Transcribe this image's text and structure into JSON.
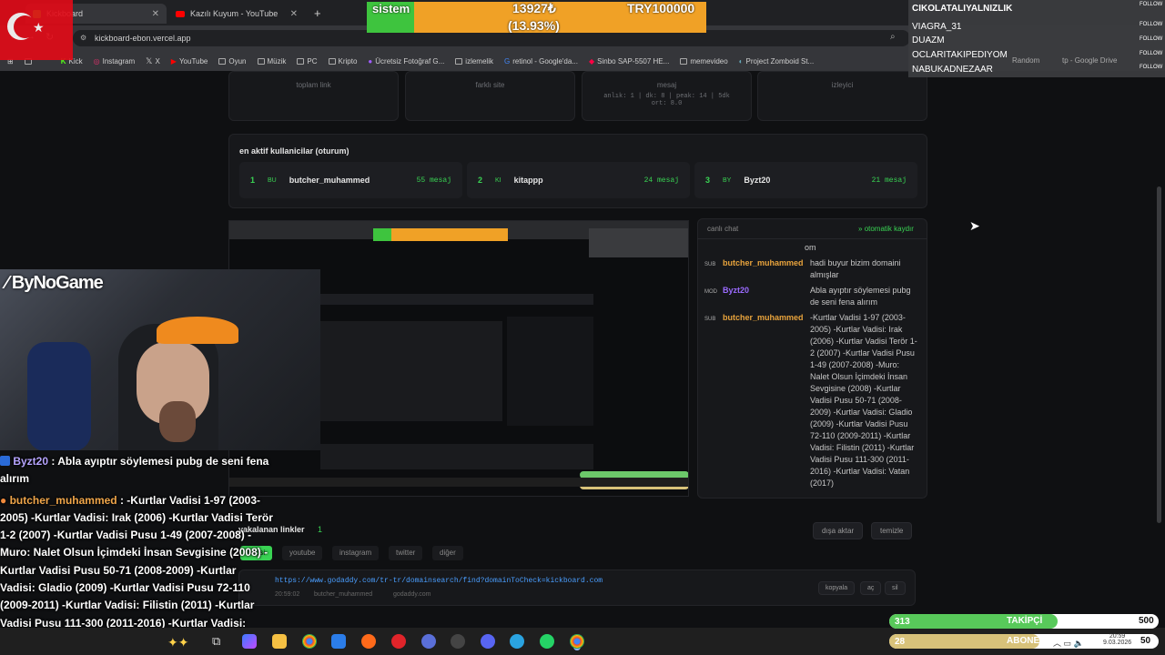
{
  "browser": {
    "tabs": [
      {
        "label": "Kickboard",
        "active": true
      },
      {
        "label": "Kazılı Kuyum - YouTube",
        "active": false
      }
    ],
    "new_tab": "+",
    "url": "kickboard-ebon.vercel.app",
    "bookmarks": [
      "Kick",
      "Instagram",
      "X",
      "YouTube",
      "Oyun",
      "Müzik",
      "PC",
      "Kripto",
      "Ücretsiz Fotoğraf G...",
      "izlemelik",
      "retinol - Google'da...",
      "Sinbo SAP-5507 HE...",
      "memevideo",
      "Project Zomboid St..."
    ],
    "bookmarks_extra": [
      "Random",
      "tp - Google Drive"
    ]
  },
  "stats": {
    "cards": [
      {
        "label": "toplam link"
      },
      {
        "label": "farklı site"
      },
      {
        "label": "mesaj",
        "sub1": "anlık: 1 | dk: 8 | peak: 14 | 5dk",
        "sub2": "ort: 8.0"
      },
      {
        "label": "izleyici"
      }
    ]
  },
  "active_users": {
    "title": "en aktif kullanicilar (oturum)",
    "items": [
      {
        "rank": "1",
        "abbr": "BU",
        "name": "butcher_muhammed",
        "count": "55 mesaj"
      },
      {
        "rank": "2",
        "abbr": "KI",
        "name": "kitappp",
        "count": "24 mesaj"
      },
      {
        "rank": "3",
        "abbr": "BY",
        "name": "Byzt20",
        "count": "21 mesaj"
      }
    ]
  },
  "live_chat": {
    "title": "canlı chat",
    "autoscroll": "otomatik kaydır",
    "partial_top": "om",
    "messages": [
      {
        "badge": "SUB",
        "user": "butcher_muhammed",
        "color": "#e8a33c",
        "text": "hadi buyur bizim domaini almışlar"
      },
      {
        "badge": "MOD",
        "user": "Byzt20",
        "color": "#9b6bff",
        "text": "Abla ayıptır söylemesi pubg de seni fena alırım"
      },
      {
        "badge": "SUB",
        "user": "butcher_muhammed",
        "color": "#e8a33c",
        "text": "-Kurtlar Vadisi 1-97 (2003-2005) -Kurtlar Vadisi: Irak (2006) -Kurtlar Vadisi Terör 1-2 (2007) -Kurtlar Vadisi Pusu 1-49 (2007-2008) -Muro: Nalet Olsun İçimdeki İnsan Sevgisine (2008) -Kurtlar Vadisi Pusu 50-71 (2008-2009) -Kurtlar Vadisi: Gladio (2009) -Kurtlar Vadisi Pusu 72-110 (2009-2011) -Kurtlar Vadisi: Filistin (2011) -Kurtlar Vadisi Pusu 111-300 (2011-2016) -Kurtlar Vadisi: Vatan (2017)"
      }
    ]
  },
  "links": {
    "title": "yakalanan linkler",
    "count": "1",
    "export": "dışa aktar",
    "clear": "temizle",
    "filters": [
      "hepsi",
      "youtube",
      "instagram",
      "twitter",
      "diğer"
    ],
    "rows": [
      {
        "url": "https://www.godaddy.com/tr-tr/domainsearch/find?domainToCheck=kickboard.com",
        "time": "20:59:02",
        "user": "butcher_muhammed",
        "site": "godaddy.com",
        "actions": [
          "kopyala",
          "aç",
          "sil"
        ]
      }
    ]
  },
  "overlay": {
    "donation_label": "sistem",
    "donation_amount": "13927₺",
    "donation_percent": "(13.93%)",
    "donation_goal": "TRY100000",
    "donation_progress": 0.1393,
    "brand": "ByNoGame",
    "follows": [
      {
        "name": "CIKOLATALIYALNIZLIK",
        "action": "FOLLOW"
      },
      {
        "name": "VIAGRA_31",
        "action": "FOLLOW"
      },
      {
        "name": "DUAZM",
        "action": "FOLLOW"
      },
      {
        "name": "OCLARITAKIPEDIYOM",
        "action": "FOLLOW"
      },
      {
        "name": "NABUKADNEZAAR",
        "action": "FOLLOW"
      }
    ],
    "cam_chat": [
      {
        "user": "Byzt20",
        "text": "Abla ayıptır söylemesi pubg de seni fena alırım"
      },
      {
        "user": "butcher_muhammed",
        "text": "-Kurtlar Vadisi 1-97 (2003-2005) -Kurtlar Vadisi: Irak (2006) -Kurtlar Vadisi Terör 1-2 (2007) -Kurtlar Vadisi Pusu 1-49 (2007-2008) -Muro: Nalet Olsun İçimdeki İnsan Sevgisine (2008) -Kurtlar Vadisi Pusu 50-71 (2008-2009) -Kurtlar Vadisi: Gladio (2009) -Kurtlar Vadisi Pusu 72-110 (2009-2011) -Kurtlar Vadisi: Filistin (2011) -Kurtlar Vadisi Pusu 111-300 (2011-2016) -Kurtlar Vadisi: Vatan (2017)"
      }
    ],
    "followers_current": "313",
    "followers_label": "TAKİPÇİ",
    "followers_goal": "500",
    "subs_current": "28",
    "subs_label": "ABONE",
    "subs_goal": "50"
  },
  "taskbar": {
    "time": "20:59",
    "date": "9.03.2026"
  },
  "colors": {
    "accent": "#39d353",
    "orange": "#f0a126",
    "background": "#0f1012"
  }
}
